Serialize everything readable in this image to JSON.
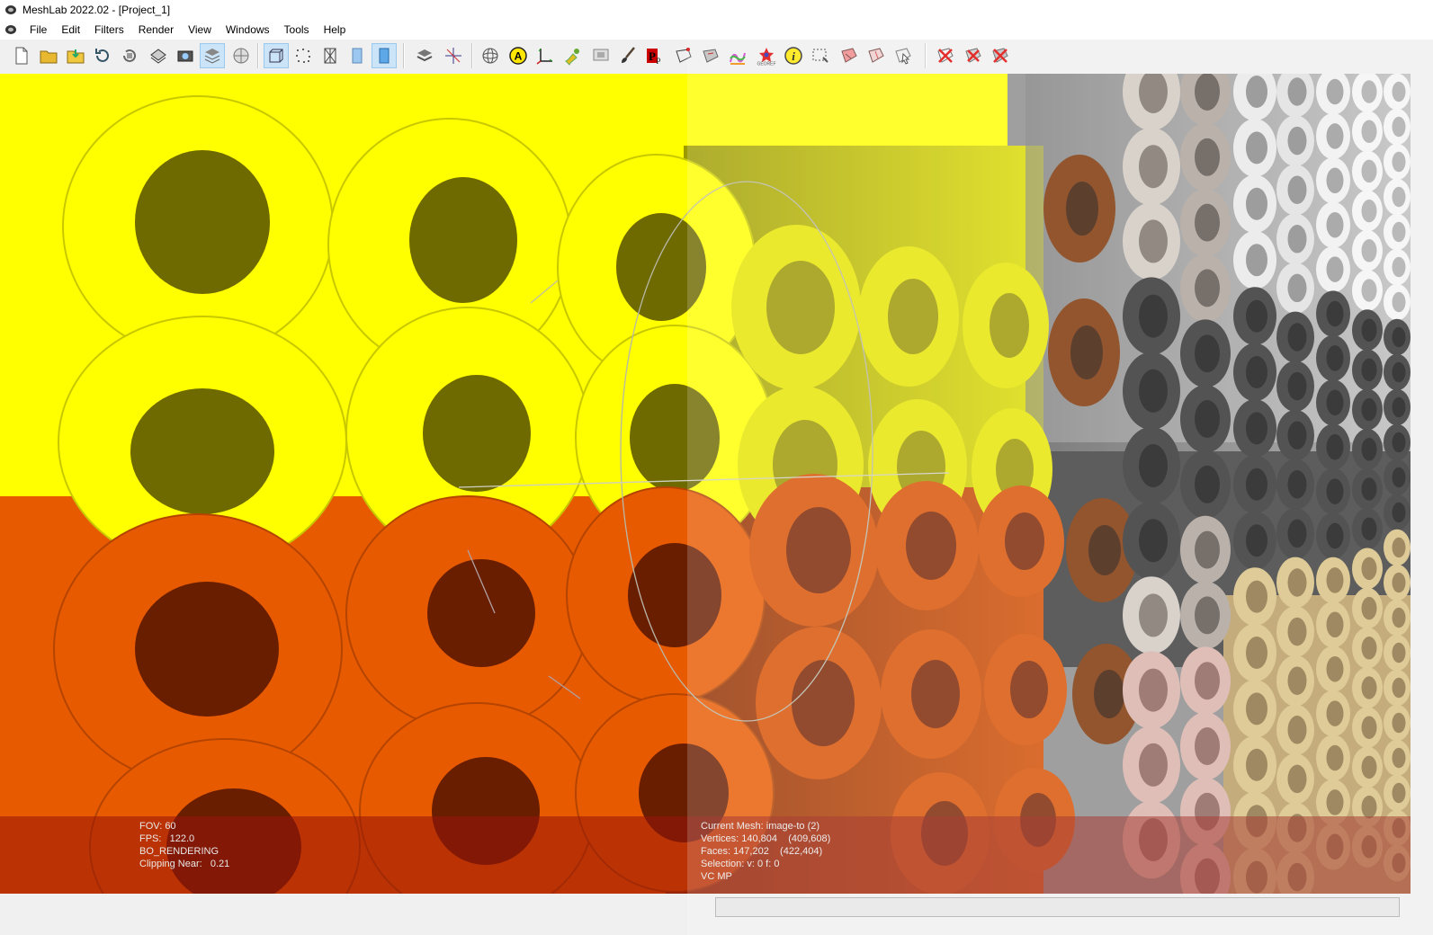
{
  "window": {
    "title": "MeshLab 2022.02 - [Project_1]"
  },
  "menu": {
    "items": [
      "File",
      "Edit",
      "Filters",
      "Render",
      "View",
      "Windows",
      "Tools",
      "Help"
    ]
  },
  "toolbar": {
    "buttons": [
      {
        "name": "new-project-icon"
      },
      {
        "name": "open-project-icon"
      },
      {
        "name": "import-mesh-icon"
      },
      {
        "name": "reload-icon"
      },
      {
        "name": "reload-all-icon"
      },
      {
        "name": "export-mesh-icon"
      },
      {
        "name": "snapshot-icon"
      },
      {
        "name": "layers-icon"
      },
      {
        "name": "raster-icon"
      },
      {
        "name": "bounding-box-icon"
      },
      {
        "name": "points-icon"
      },
      {
        "name": "wireframe-icon"
      },
      {
        "name": "flat-icon"
      },
      {
        "name": "smooth-icon"
      },
      {
        "name": "layer-dialog-icon"
      },
      {
        "name": "manipulator-icon"
      },
      {
        "name": "trackball-icon"
      },
      {
        "name": "annotation-icon"
      },
      {
        "name": "measure-axis-icon"
      },
      {
        "name": "paint-icon"
      },
      {
        "name": "align-icon"
      },
      {
        "name": "brush-icon"
      },
      {
        "name": "point-picker-icon"
      },
      {
        "name": "select-vertices-icon"
      },
      {
        "name": "select-faces-icon"
      },
      {
        "name": "quality-mapper-icon"
      },
      {
        "name": "georef-icon"
      },
      {
        "name": "info-icon"
      },
      {
        "name": "select-region-icon"
      },
      {
        "name": "select-connected-icon"
      },
      {
        "name": "select-fragment-icon"
      },
      {
        "name": "select-cursor-icon"
      },
      {
        "name": "delete-vertices-icon"
      },
      {
        "name": "delete-faces-icon"
      },
      {
        "name": "delete-all-icon"
      }
    ]
  },
  "info": {
    "left": [
      "FOV: 60",
      "FPS:   122.0",
      "BO_RENDERING",
      "Clipping Near:   0.21"
    ],
    "right": [
      "Current Mesh: image-to (2)",
      "Vertices: 140,804    (409,608)",
      "Faces: 147,202    (422,404)",
      "Selection: v: 0 f: 0",
      "VC MP"
    ]
  },
  "colors": {
    "yellow": "#ffff00",
    "orange": "#e85a00",
    "brown": "#8b2f08",
    "panel": "#a0200e"
  }
}
